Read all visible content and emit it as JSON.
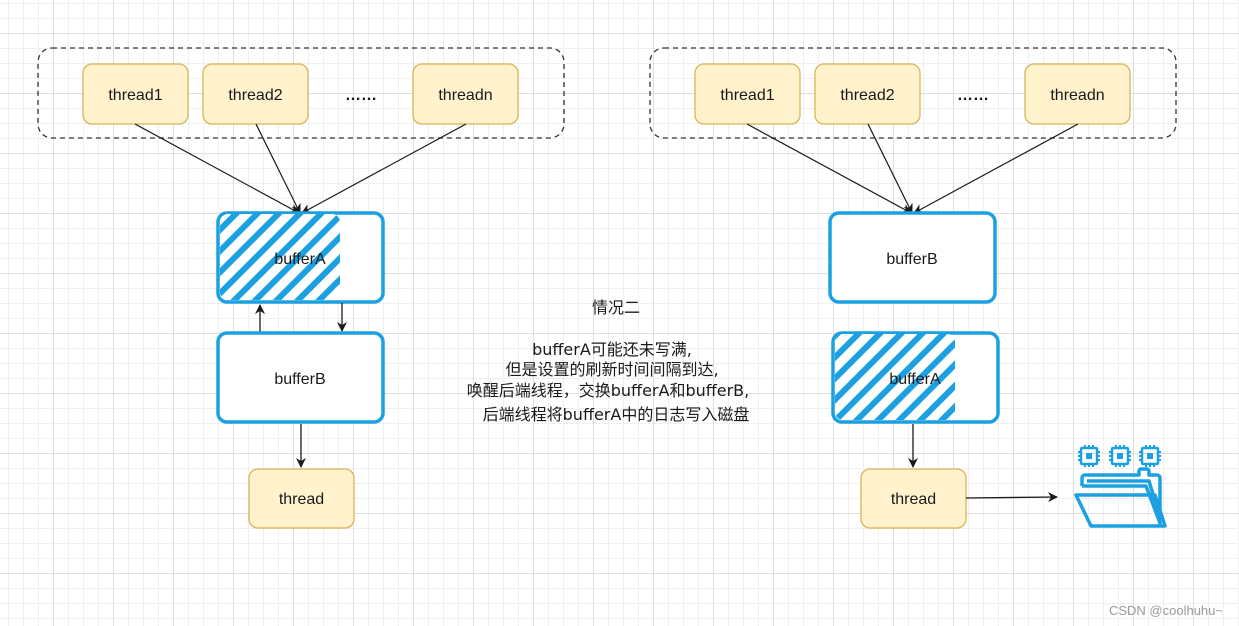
{
  "colors": {
    "thread_fill": "#fff2cc",
    "thread_stroke": "#d6b656",
    "buffer_stroke": "#1ba1e2",
    "arrow": "#1a1a1a",
    "group_border": "#333333"
  },
  "left": {
    "threads": [
      "thread1",
      "thread2",
      "threadn"
    ],
    "ellipsis": "……",
    "buffer_top": "bufferA",
    "buffer_bottom": "bufferB",
    "consumer": "thread"
  },
  "right": {
    "threads": [
      "thread1",
      "thread2",
      "threadn"
    ],
    "ellipsis": "……",
    "buffer_top": "bufferB",
    "buffer_bottom": "bufferA",
    "consumer": "thread",
    "storage_icon": "folder-with-chips-icon"
  },
  "caption": {
    "title": "情况二",
    "lines": [
      "bufferA可能还未写满,",
      "但是设置的刷新时间间隔到达,",
      "唤醒后端线程，交换bufferA和bufferB,",
      "后端线程将bufferA中的日志写入磁盘"
    ]
  },
  "watermark": "CSDN @coolhuhu~"
}
